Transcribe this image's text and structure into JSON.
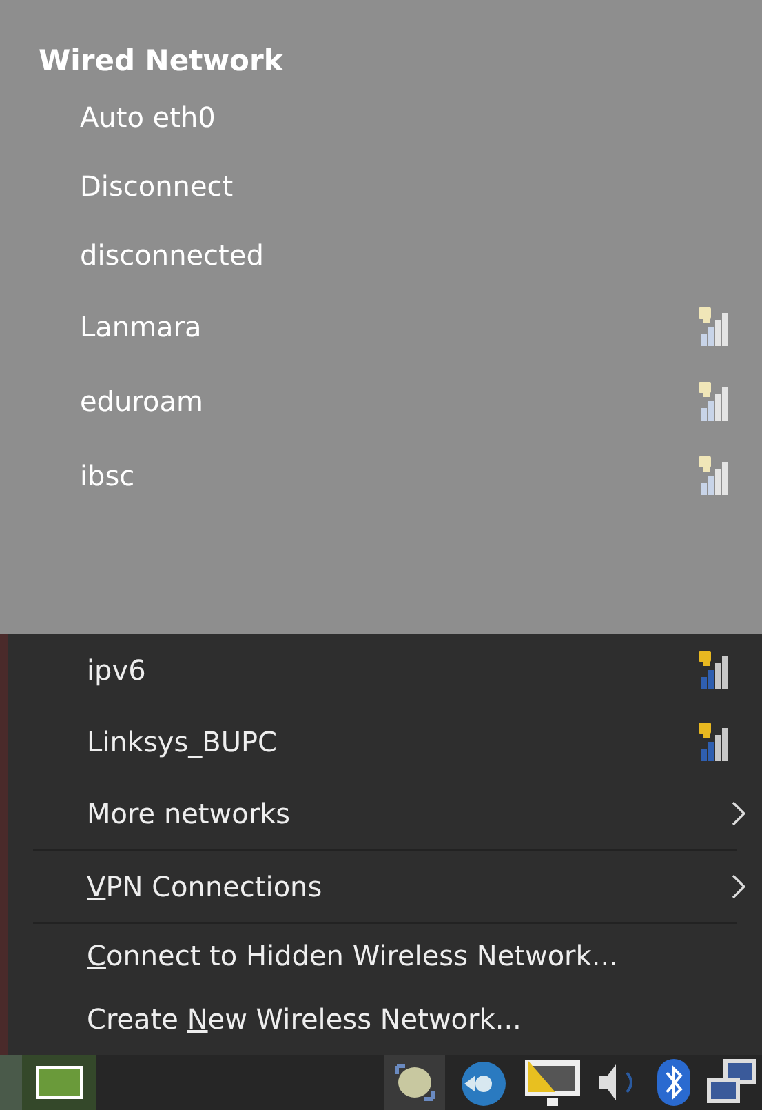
{
  "faded_menu": [
    {
      "kind": "header",
      "label": "Wired Network"
    },
    {
      "kind": "item",
      "label": "Auto eth0"
    },
    {
      "kind": "item",
      "label": "Disconnect"
    },
    {
      "kind": "item",
      "label": "disconnected"
    },
    {
      "kind": "wifi",
      "label": "Lanmara"
    },
    {
      "kind": "wifi",
      "label": "eduroam"
    },
    {
      "kind": "wifi",
      "label": "ibsc"
    }
  ],
  "menu": [
    {
      "kind": "wifi",
      "label": "ipv6"
    },
    {
      "kind": "wifi",
      "label": "Linksys_BUPC"
    },
    {
      "kind": "submenu",
      "label": "More networks"
    },
    {
      "kind": "separator"
    },
    {
      "kind": "submenu",
      "key": "V",
      "after": "PN Connections"
    },
    {
      "kind": "separator"
    },
    {
      "kind": "action",
      "key": "C",
      "after": "onnect to Hidden Wireless Network..."
    },
    {
      "kind": "action",
      "before": "Create ",
      "key": "N",
      "after": "ew Wireless Network..."
    }
  ]
}
